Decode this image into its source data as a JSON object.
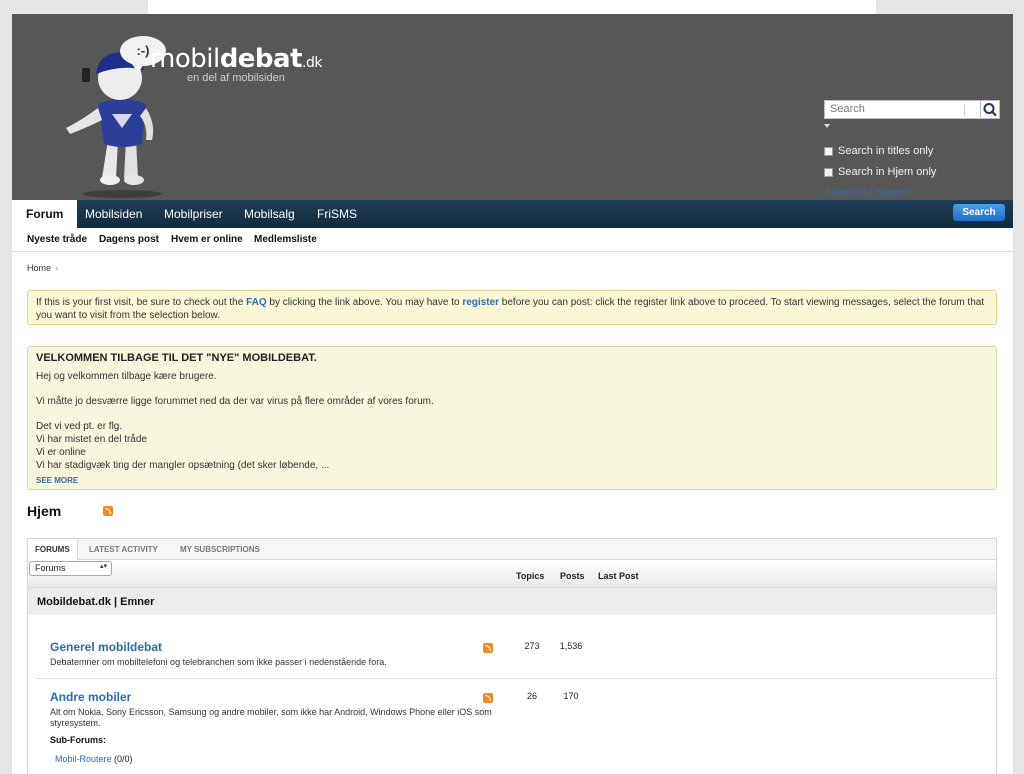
{
  "header": {
    "logo_bubble": ":-)",
    "logo_main": "mobil",
    "logo_bold": "debat",
    "logo_tld": ".dk",
    "logo_sub": "en del af mobilsiden",
    "search_placeholder": "Search",
    "search_titles_only": "Search in titles only",
    "search_hjem_only": "Search in Hjem only",
    "advanced_search": "Advanced Search"
  },
  "nav": {
    "tabs": [
      "Forum",
      "Mobilsiden",
      "Mobilpriser",
      "Mobilsalg",
      "FriSMS"
    ],
    "search_button": "Search",
    "sub": [
      "Nyeste tråde",
      "Dagens post",
      "Hvem er online",
      "Medlemsliste"
    ]
  },
  "breadcrumb": {
    "home": "Home",
    "sep": "›"
  },
  "notice": {
    "t1": "If this is your first visit, be sure to check out the ",
    "faq": "FAQ",
    "t2": " by clicking the link above. You may have to ",
    "register": "register",
    "t3": " before you can post: click the register link above to proceed. To start viewing messages, select the forum that you want to visit from the selection below."
  },
  "announcement": {
    "title": "VELKOMMEN TILBAGE TIL DET \"NYE\" MOBILDEBAT.",
    "line1": "Hej og velkommen tilbage kære brugere.",
    "line2": "Vi måtte jo desværre ligge forummet ned da der var virus på flere områder af vores forum.",
    "line3": "Det vi ved pt. er flg.",
    "line4": "Vi har mistet en del tråde",
    "line5": "Vi er online",
    "line6": "Vi har stadigvæk ting der mangler opsætning (det sker løbende, ...",
    "see_more": "SEE MORE"
  },
  "section": {
    "title": "Hjem"
  },
  "forums": {
    "tabs": [
      "FORUMS",
      "LATEST ACTIVITY",
      "MY SUBSCRIPTIONS"
    ],
    "select_value": "Forums",
    "col_topics": "Topics",
    "col_posts": "Posts",
    "col_last_post": "Last Post",
    "category": "Mobildebat.dk | Emner",
    "rows": [
      {
        "title": "Generel mobildebat",
        "desc": "Debatemner om mobiltelefoni og telebranchen som ikke passer i nedenstående fora.",
        "topics": "273",
        "posts": "1,536"
      },
      {
        "title": "Andre mobiler",
        "desc": "Alt om Nokia, Sony Ericsson, Samsung og andre mobiler, som ikke har Android, Windows Phone eller iOS som styresystem.",
        "topics": "26",
        "posts": "170",
        "sub_label": "Sub-Forums:",
        "sub_link": "Mobil-Routere",
        "sub_count": "(0/0)"
      }
    ]
  },
  "colors": {
    "header_bg": "#575757",
    "nav_bg": "#1e3d56",
    "link": "#2b6bb0",
    "notice_bg": "#fcf7d6",
    "rss": "#f08a24"
  }
}
